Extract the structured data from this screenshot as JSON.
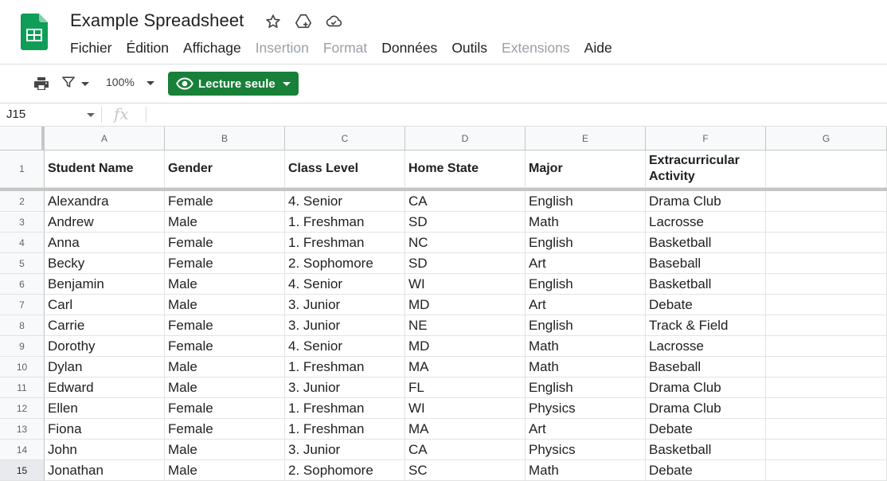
{
  "app": {
    "doc_title": "Example Spreadsheet",
    "icons": [
      "star-icon",
      "move-to-drive-icon",
      "cloud-status-icon"
    ]
  },
  "menu": [
    "Fichier",
    "Édition",
    "Affichage",
    "Insertion",
    "Format",
    "Données",
    "Outils",
    "Extensions",
    "Aide"
  ],
  "menu_disabled": [
    "Insertion",
    "Format",
    "Extensions"
  ],
  "toolbar": {
    "zoom": "100%",
    "readonly_label": "Lecture seule",
    "accent_color": "#188038"
  },
  "formula_bar": {
    "cell_ref": "J15",
    "fx_label": "fx",
    "content": ""
  },
  "sheet": {
    "columns": [
      "A",
      "B",
      "C",
      "D",
      "E",
      "F",
      "G"
    ],
    "selected_row": "15",
    "header_row": {
      "row_number": "1",
      "cells": [
        "Student Name",
        "Gender",
        "Class Level",
        "Home State",
        "Major",
        "Extracurricular Activity",
        ""
      ]
    },
    "rows": [
      {
        "n": "2",
        "cells": [
          "Alexandra",
          "Female",
          "4. Senior",
          "CA",
          "English",
          "Drama Club",
          ""
        ]
      },
      {
        "n": "3",
        "cells": [
          "Andrew",
          "Male",
          "1. Freshman",
          "SD",
          "Math",
          "Lacrosse",
          ""
        ]
      },
      {
        "n": "4",
        "cells": [
          "Anna",
          "Female",
          "1. Freshman",
          "NC",
          "English",
          "Basketball",
          ""
        ]
      },
      {
        "n": "5",
        "cells": [
          "Becky",
          "Female",
          "2. Sophomore",
          "SD",
          "Art",
          "Baseball",
          ""
        ]
      },
      {
        "n": "6",
        "cells": [
          "Benjamin",
          "Male",
          "4. Senior",
          "WI",
          "English",
          "Basketball",
          ""
        ]
      },
      {
        "n": "7",
        "cells": [
          "Carl",
          "Male",
          "3. Junior",
          "MD",
          "Art",
          "Debate",
          ""
        ]
      },
      {
        "n": "8",
        "cells": [
          "Carrie",
          "Female",
          "3. Junior",
          "NE",
          "English",
          "Track & Field",
          ""
        ]
      },
      {
        "n": "9",
        "cells": [
          "Dorothy",
          "Female",
          "4. Senior",
          "MD",
          "Math",
          "Lacrosse",
          ""
        ]
      },
      {
        "n": "10",
        "cells": [
          "Dylan",
          "Male",
          "1. Freshman",
          "MA",
          "Math",
          "Baseball",
          ""
        ]
      },
      {
        "n": "11",
        "cells": [
          "Edward",
          "Male",
          "3. Junior",
          "FL",
          "English",
          "Drama Club",
          ""
        ]
      },
      {
        "n": "12",
        "cells": [
          "Ellen",
          "Female",
          "1. Freshman",
          "WI",
          "Physics",
          "Drama Club",
          ""
        ]
      },
      {
        "n": "13",
        "cells": [
          "Fiona",
          "Female",
          "1. Freshman",
          "MA",
          "Art",
          "Debate",
          ""
        ]
      },
      {
        "n": "14",
        "cells": [
          "John",
          "Male",
          "3. Junior",
          "CA",
          "Physics",
          "Basketball",
          ""
        ]
      },
      {
        "n": "15",
        "cells": [
          "Jonathan",
          "Male",
          "2. Sophomore",
          "SC",
          "Math",
          "Debate",
          ""
        ]
      }
    ]
  }
}
